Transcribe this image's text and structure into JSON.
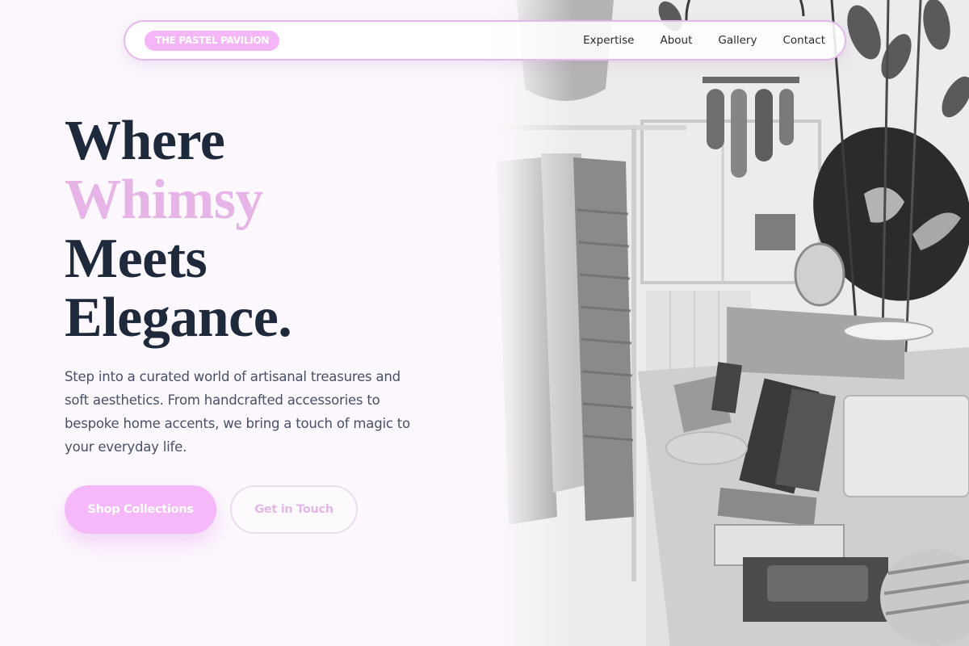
{
  "nav": {
    "brand": "THE PASTEL PAVILION",
    "links": [
      "Expertise",
      "About",
      "Gallery",
      "Contact"
    ]
  },
  "hero": {
    "title_lines": [
      "Where",
      "Whimsy",
      "Meets",
      "Elegance."
    ],
    "description": "Step into a curated world of artisanal treasures and soft aesthetics. From handcrafted accessories to bespoke home accents, we bring a touch of magic to your everyday life.",
    "primary_button": "Shop Collections",
    "secondary_button": "Get in Touch"
  },
  "colors": {
    "accent_pink": "#f5b6f7",
    "title_accent": "#e6b4e6",
    "heading": "#1e293b",
    "background": "#fcf8fd"
  },
  "image": {
    "description_icon": "boutique-photo"
  }
}
